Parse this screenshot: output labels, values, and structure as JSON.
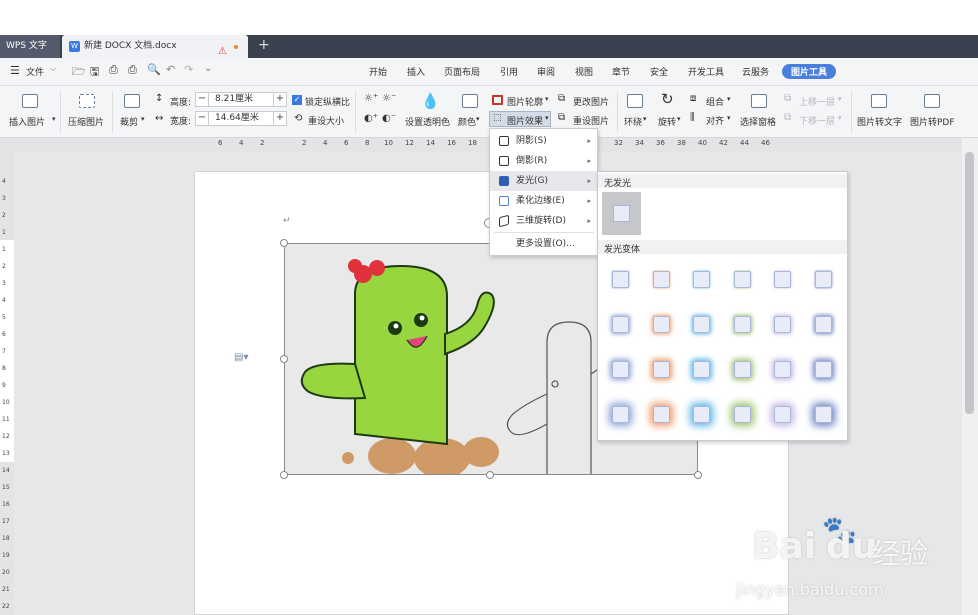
{
  "tabs": {
    "app": "WPS 文字",
    "doc": "新建 DOCX 文档.docx",
    "doc_icon": "W"
  },
  "menu": {
    "file": "文件",
    "items": [
      "开始",
      "插入",
      "页面布局",
      "引用",
      "审阅",
      "视图",
      "章节",
      "安全",
      "开发工具",
      "云服务"
    ],
    "active": "图片工具"
  },
  "ribbon": {
    "insert_image": "插入图片",
    "compress": "压缩图片",
    "crop": "裁剪",
    "height_label": "高度:",
    "height_value": "8.21厘米",
    "width_label": "宽度:",
    "width_value": "14.64厘米",
    "lock_ratio": "锁定纵横比",
    "reset_size": "重设大小",
    "set_transparent": "设置透明色",
    "color": "颜色",
    "outline": "图片轮廓",
    "effects": "图片效果",
    "change_image": "更改图片",
    "reset_image": "重设图片",
    "wrap": "环绕",
    "rotate": "旋转",
    "group": "组合",
    "align": "对齐",
    "select_pane": "选择窗格",
    "bring_forward": "上移一层",
    "send_backward": "下移一层",
    "to_text": "图片转文字",
    "to_pdf": "图片转PDF"
  },
  "ruler_ticks": [
    "6",
    "4",
    "2",
    "2",
    "4",
    "6",
    "8",
    "10",
    "12",
    "14",
    "16",
    "18",
    "32",
    "34",
    "36",
    "38",
    "40",
    "42",
    "44",
    "46"
  ],
  "vruler_ticks": [
    "4",
    "3",
    "2",
    "1",
    "1",
    "2",
    "3",
    "4",
    "5",
    "6",
    "7",
    "8",
    "9",
    "10",
    "11",
    "12",
    "13",
    "14",
    "15",
    "16",
    "17",
    "18",
    "19",
    "20",
    "21",
    "22"
  ],
  "effects_menu": {
    "items": [
      {
        "label": "阴影(S)",
        "arrow": true
      },
      {
        "label": "倒影(R)",
        "arrow": true
      },
      {
        "label": "发光(G)",
        "arrow": true
      },
      {
        "label": "柔化边缘(E)",
        "arrow": true
      },
      {
        "label": "三维旋转(D)",
        "arrow": true
      },
      {
        "label": "更多设置(O)...",
        "arrow": false
      }
    ],
    "highlighted": 2
  },
  "glow_panel": {
    "no_glow": "无发光",
    "variants": "发光变体",
    "colors": [
      "#8fa3d6",
      "#f09a6a",
      "#5ab3e6",
      "#9cc46c",
      "#c8b8e8",
      "#6f85c2"
    ]
  },
  "watermark": {
    "brand": "Bai",
    "brand2": "du",
    "site": "经验",
    "url": "jingyan.baidu.com"
  }
}
